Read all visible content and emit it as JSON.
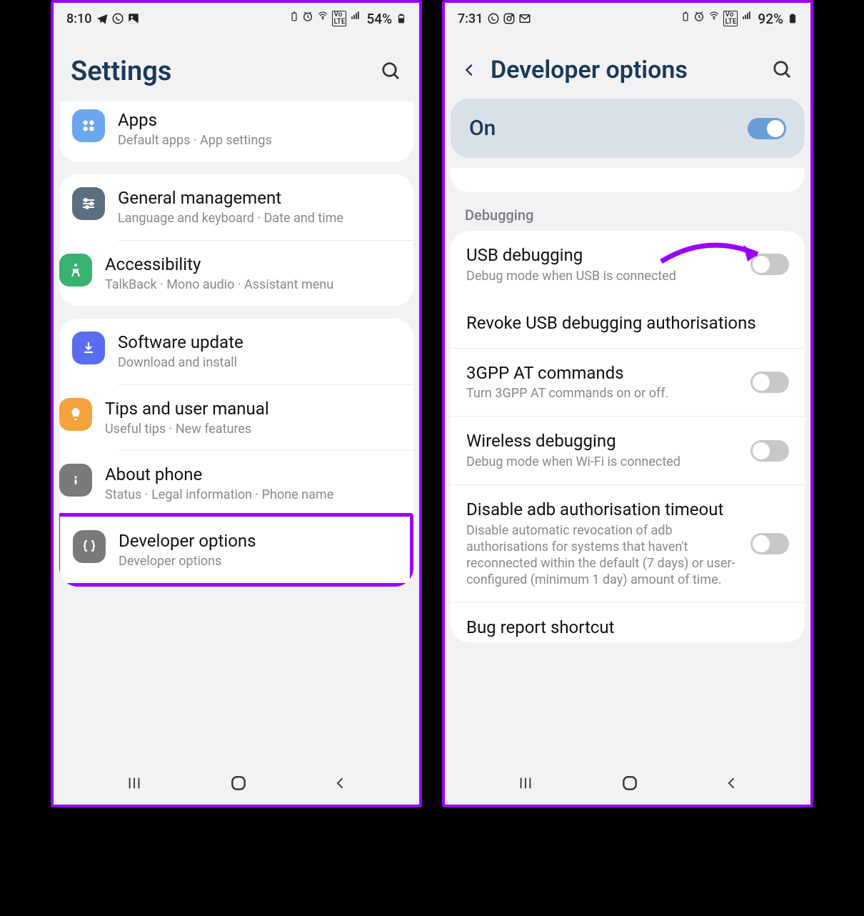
{
  "left": {
    "status": {
      "time": "8:10",
      "battery": "54%"
    },
    "title": "Settings",
    "groups": [
      {
        "rows": [
          {
            "icon_color": "#6aa5f0",
            "title": "Apps",
            "sub": "Default apps  ·  App settings"
          }
        ]
      },
      {
        "rows": [
          {
            "icon_color": "#5c6f80",
            "title": "General management",
            "sub": "Language and keyboard  ·  Date and time"
          },
          {
            "icon_color": "#38b26e",
            "title": "Accessibility",
            "sub": "TalkBack  ·  Mono audio  ·  Assistant menu"
          }
        ]
      },
      {
        "rows": [
          {
            "icon_color": "#5a6cf0",
            "title": "Software update",
            "sub": "Download and install"
          },
          {
            "icon_color": "#f6a23c",
            "title": "Tips and user manual",
            "sub": "Useful tips  ·  New features"
          },
          {
            "icon_color": "#7a7a7a",
            "title": "About phone",
            "sub": "Status  ·  Legal information  ·  Phone name"
          },
          {
            "icon_color": "#7a7a7a",
            "title": "Developer options",
            "sub": "Developer options",
            "highlighted": true
          }
        ]
      }
    ]
  },
  "right": {
    "status": {
      "time": "7:31",
      "battery": "92%"
    },
    "title": "Developer options",
    "master_toggle": {
      "label": "On",
      "on": true
    },
    "section": "Debugging",
    "settings": [
      {
        "title": "USB debugging",
        "sub": "Debug mode when USB is connected",
        "toggle": false,
        "arrow": true
      },
      {
        "title": "Revoke USB debugging authorisations",
        "sub": "",
        "toggle": null
      },
      {
        "title": "3GPP AT commands",
        "sub": "Turn 3GPP AT commands on or off.",
        "toggle": false
      },
      {
        "title": "Wireless debugging",
        "sub": "Debug mode when Wi-Fi is connected",
        "toggle": false
      },
      {
        "title": "Disable adb authorisation timeout",
        "sub": "Disable automatic revocation of adb authorisations for systems that haven't reconnected within the default (7 days) or user-configured (minimum 1 day) amount of time.",
        "toggle": false
      },
      {
        "title": "Bug report shortcut",
        "sub": "",
        "toggle": null
      }
    ]
  }
}
